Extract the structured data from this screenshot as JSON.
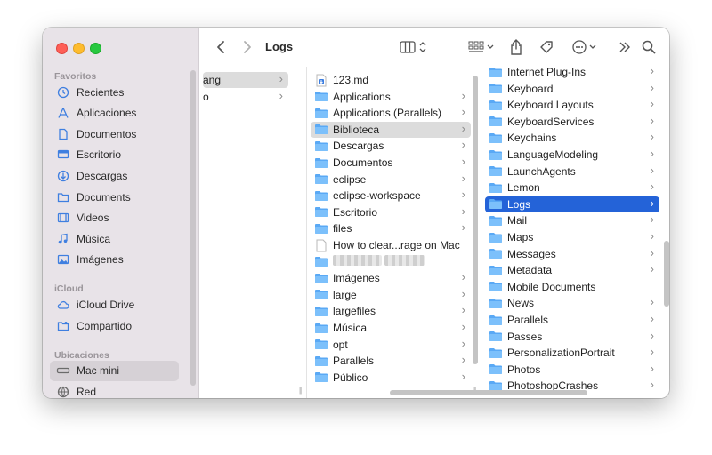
{
  "window": {
    "title": "Logs"
  },
  "colors": {
    "selection_blue": "#2463d8",
    "folder_blue": "#5aa9f5",
    "sidebar_icon": "#3f7fe0",
    "sidebar_bg": "#e8e3e8"
  },
  "sidebar": {
    "sections": [
      {
        "label": "Favoritos",
        "items": [
          {
            "label": "Recientes",
            "icon": "clock-icon"
          },
          {
            "label": "Aplicaciones",
            "icon": "applications-icon"
          },
          {
            "label": "Documentos",
            "icon": "document-icon"
          },
          {
            "label": "Escritorio",
            "icon": "desktop-icon"
          },
          {
            "label": "Descargas",
            "icon": "download-icon"
          },
          {
            "label": "Documents",
            "icon": "folder-icon"
          },
          {
            "label": "Videos",
            "icon": "film-icon"
          },
          {
            "label": "Música",
            "icon": "music-icon"
          },
          {
            "label": "Imágenes",
            "icon": "photo-icon"
          }
        ]
      },
      {
        "label": "iCloud",
        "items": [
          {
            "label": "iCloud Drive",
            "icon": "cloud-icon"
          },
          {
            "label": "Compartido",
            "icon": "shared-folder-icon"
          }
        ]
      },
      {
        "label": "Ubicaciones",
        "items": [
          {
            "label": "Mac mini",
            "icon": "computer-icon",
            "selected": true
          },
          {
            "label": "Red",
            "icon": "globe-icon"
          }
        ]
      }
    ]
  },
  "toolbar": {
    "back_icon": "chevron-left-icon",
    "forward_icon": "chevron-right-icon",
    "view_icon": "columns-view-icon",
    "group_icon": "grid-icon",
    "share_icon": "share-icon",
    "tag_icon": "tag-icon",
    "more_icon": "ellipsis-circle-icon",
    "overflow_icon": "double-chevron-icon",
    "search_icon": "search-icon"
  },
  "columns": {
    "col1": {
      "items": [
        {
          "label": "ang",
          "selected": "gray"
        },
        {
          "label": "o"
        }
      ]
    },
    "col2": {
      "items": [
        {
          "label": "123.md",
          "icon": "md-file-icon",
          "chevron": false
        },
        {
          "label": "Applications",
          "chevron": true
        },
        {
          "label": "Applications (Parallels)",
          "chevron": true
        },
        {
          "label": "Biblioteca",
          "chevron": true,
          "selected": "gray"
        },
        {
          "label": "Descargas",
          "chevron": true
        },
        {
          "label": "Documentos",
          "chevron": true
        },
        {
          "label": "eclipse",
          "chevron": true
        },
        {
          "label": "eclipse-workspace",
          "chevron": true
        },
        {
          "label": "Escritorio",
          "chevron": true
        },
        {
          "label": "files",
          "chevron": true
        },
        {
          "label": "How to clear...rage on Mac",
          "icon": "doc-file-icon",
          "chevron": false
        },
        {
          "label": "",
          "blurred": true,
          "chevron": false
        },
        {
          "label": "Imágenes",
          "chevron": true
        },
        {
          "label": "large",
          "chevron": true
        },
        {
          "label": "largefiles",
          "chevron": true
        },
        {
          "label": "Música",
          "chevron": true
        },
        {
          "label": "opt",
          "chevron": true
        },
        {
          "label": "Parallels",
          "chevron": true
        },
        {
          "label": "Público",
          "chevron": true
        }
      ]
    },
    "col3": {
      "items": [
        {
          "label": "Internet Plug-Ins",
          "chevron": true
        },
        {
          "label": "Keyboard",
          "chevron": true
        },
        {
          "label": "Keyboard Layouts",
          "chevron": true
        },
        {
          "label": "KeyboardServices",
          "chevron": true
        },
        {
          "label": "Keychains",
          "chevron": true
        },
        {
          "label": "LanguageModeling",
          "chevron": true
        },
        {
          "label": "LaunchAgents",
          "chevron": true
        },
        {
          "label": "Lemon",
          "chevron": true
        },
        {
          "label": "Logs",
          "chevron": true,
          "selected": "blue"
        },
        {
          "label": "Mail",
          "chevron": true
        },
        {
          "label": "Maps",
          "chevron": true
        },
        {
          "label": "Messages",
          "chevron": true
        },
        {
          "label": "Metadata",
          "chevron": true
        },
        {
          "label": "Mobile Documents",
          "chevron": false
        },
        {
          "label": "News",
          "chevron": true
        },
        {
          "label": "Parallels",
          "chevron": true
        },
        {
          "label": "Passes",
          "chevron": true
        },
        {
          "label": "PersonalizationPortrait",
          "chevron": true
        },
        {
          "label": "Photos",
          "chevron": true
        },
        {
          "label": "PhotoshopCrashes",
          "chevron": true
        }
      ]
    }
  }
}
